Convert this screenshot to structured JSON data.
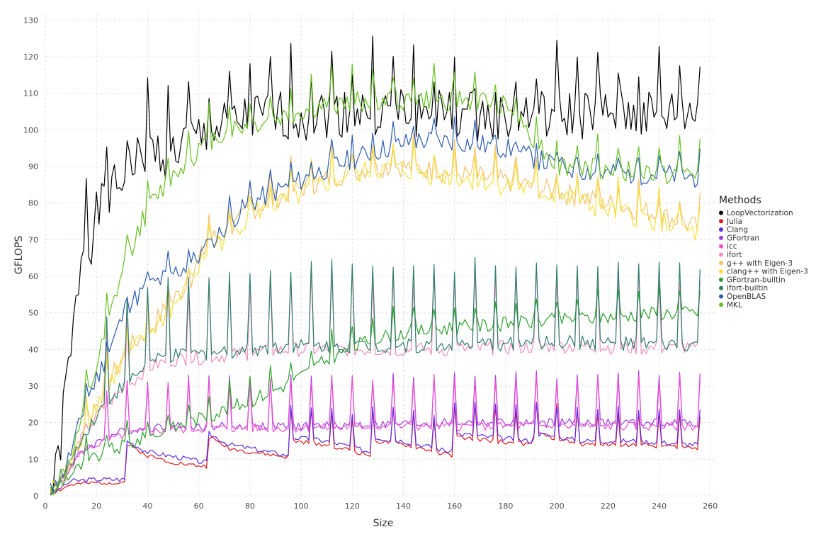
{
  "chart_data": {
    "type": "line",
    "title": "",
    "xlabel": "Size",
    "ylabel": "GFLOPS",
    "xlim": [
      0,
      262
    ],
    "ylim": [
      0,
      132
    ],
    "x_ticks": [
      0,
      20,
      40,
      60,
      80,
      100,
      120,
      140,
      160,
      180,
      200,
      220,
      240,
      260
    ],
    "y_ticks": [
      0,
      10,
      20,
      30,
      40,
      50,
      60,
      70,
      80,
      90,
      100,
      110,
      120,
      130
    ],
    "grid": true,
    "legend": {
      "title": "Methods",
      "placement": "right"
    },
    "x_domain": [
      2,
      256
    ],
    "series": [
      {
        "name": "LoopVectorization",
        "color": "#000000",
        "anchors": [
          [
            2,
            1
          ],
          [
            4,
            5
          ],
          [
            6,
            15
          ],
          [
            8,
            30
          ],
          [
            10,
            38
          ],
          [
            12,
            52
          ],
          [
            14,
            66
          ],
          [
            16,
            74
          ],
          [
            18,
            70
          ],
          [
            20,
            76
          ],
          [
            24,
            82
          ],
          [
            28,
            84
          ],
          [
            32,
            88
          ],
          [
            40,
            95
          ],
          [
            48,
            93
          ],
          [
            56,
            97
          ],
          [
            64,
            99
          ],
          [
            72,
            101
          ],
          [
            80,
            103
          ],
          [
            100,
            104
          ],
          [
            120,
            105
          ],
          [
            140,
            105
          ],
          [
            160,
            104
          ],
          [
            180,
            103
          ],
          [
            200,
            104
          ],
          [
            220,
            104
          ],
          [
            240,
            104
          ],
          [
            256,
            105
          ]
        ],
        "noise": 7,
        "spikes": {
          "period": 8,
          "amp": 14,
          "start": 16
        },
        "seed": 1
      },
      {
        "name": "Julia",
        "color": "#e41a1c",
        "anchors": [
          [
            2,
            0.5
          ],
          [
            10,
            3
          ],
          [
            20,
            3.5
          ],
          [
            31,
            3.8
          ],
          [
            32,
            14
          ],
          [
            40,
            11
          ],
          [
            48,
            9.5
          ],
          [
            56,
            8.5
          ],
          [
            63,
            8
          ],
          [
            64,
            16
          ],
          [
            72,
            13
          ],
          [
            80,
            12
          ],
          [
            95,
            10.5
          ],
          [
            96,
            15
          ],
          [
            110,
            14
          ],
          [
            127,
            11
          ],
          [
            128,
            15
          ],
          [
            140,
            14
          ],
          [
            159,
            11
          ],
          [
            160,
            16
          ],
          [
            190,
            14
          ],
          [
            192,
            17
          ],
          [
            210,
            14
          ],
          [
            230,
            14
          ],
          [
            256,
            13
          ]
        ],
        "noise": 0.6,
        "spikes": {
          "period": 8,
          "amp": 9,
          "start": 96
        },
        "seed": 2
      },
      {
        "name": "Clang",
        "color": "#5e2ce6",
        "anchors": [
          [
            2,
            0.5
          ],
          [
            10,
            4
          ],
          [
            20,
            4.5
          ],
          [
            31,
            4.5
          ],
          [
            32,
            15
          ],
          [
            40,
            12
          ],
          [
            48,
            11
          ],
          [
            56,
            10
          ],
          [
            63,
            9
          ],
          [
            64,
            17
          ],
          [
            72,
            14
          ],
          [
            80,
            13
          ],
          [
            95,
            11
          ],
          [
            96,
            16
          ],
          [
            110,
            15
          ],
          [
            127,
            12
          ],
          [
            128,
            16
          ],
          [
            140,
            15
          ],
          [
            159,
            12
          ],
          [
            160,
            17
          ],
          [
            190,
            15
          ],
          [
            192,
            17
          ],
          [
            210,
            15
          ],
          [
            230,
            15
          ],
          [
            256,
            14
          ]
        ],
        "noise": 0.7,
        "spikes": {
          "period": 8,
          "amp": 9,
          "start": 96
        },
        "seed": 3
      },
      {
        "name": "GFortran",
        "color": "#a23be0",
        "anchors": [
          [
            2,
            1
          ],
          [
            8,
            6
          ],
          [
            12,
            10
          ],
          [
            16,
            13
          ],
          [
            24,
            16
          ],
          [
            32,
            18
          ],
          [
            48,
            19
          ],
          [
            64,
            19
          ],
          [
            96,
            19
          ],
          [
            128,
            19.5
          ],
          [
            160,
            20
          ],
          [
            200,
            20
          ],
          [
            256,
            20
          ]
        ],
        "noise": 1.2,
        "spikes": {
          "period": 8,
          "amp": 13,
          "start": 24
        },
        "seed": 4
      },
      {
        "name": "icc",
        "color": "#ee4fd4",
        "anchors": [
          [
            2,
            1
          ],
          [
            8,
            6
          ],
          [
            12,
            10
          ],
          [
            16,
            13
          ],
          [
            24,
            15
          ],
          [
            32,
            17
          ],
          [
            48,
            18
          ],
          [
            64,
            18.5
          ],
          [
            96,
            18.5
          ],
          [
            128,
            19
          ],
          [
            160,
            19
          ],
          [
            200,
            19
          ],
          [
            256,
            19
          ]
        ],
        "noise": 1.2,
        "spikes": {
          "period": 8,
          "amp": 13,
          "start": 24
        },
        "seed": 5
      },
      {
        "name": "ifort",
        "color": "#f08fc0",
        "anchors": [
          [
            2,
            1
          ],
          [
            8,
            6
          ],
          [
            12,
            12
          ],
          [
            16,
            18
          ],
          [
            24,
            25
          ],
          [
            32,
            30
          ],
          [
            40,
            35
          ],
          [
            48,
            37
          ],
          [
            64,
            38
          ],
          [
            96,
            40
          ],
          [
            128,
            40
          ],
          [
            160,
            40
          ],
          [
            200,
            41
          ],
          [
            256,
            40
          ]
        ],
        "noise": 2,
        "spikes": {
          "period": 8,
          "amp": 20,
          "start": 24
        },
        "seed": 6
      },
      {
        "name": "g++ with Eigen-3",
        "color": "#f5c26b",
        "anchors": [
          [
            2,
            1
          ],
          [
            8,
            6
          ],
          [
            12,
            12
          ],
          [
            16,
            20
          ],
          [
            24,
            30
          ],
          [
            32,
            40
          ],
          [
            40,
            45
          ],
          [
            48,
            52
          ],
          [
            56,
            58
          ],
          [
            64,
            70
          ],
          [
            72,
            72
          ],
          [
            80,
            78
          ],
          [
            96,
            83
          ],
          [
            112,
            87
          ],
          [
            128,
            90
          ],
          [
            140,
            90
          ],
          [
            160,
            88
          ],
          [
            180,
            86
          ],
          [
            200,
            83
          ],
          [
            220,
            80
          ],
          [
            240,
            77
          ],
          [
            256,
            73
          ]
        ],
        "noise": 3,
        "spikes": {
          "period": 8,
          "amp": 7,
          "start": 16
        },
        "seed": 7
      },
      {
        "name": "clang++ with Eigen-3",
        "color": "#f7e03c",
        "anchors": [
          [
            2,
            1
          ],
          [
            8,
            6
          ],
          [
            12,
            12
          ],
          [
            16,
            20
          ],
          [
            24,
            30
          ],
          [
            32,
            38
          ],
          [
            40,
            44
          ],
          [
            48,
            50
          ],
          [
            56,
            57
          ],
          [
            64,
            68
          ],
          [
            72,
            71
          ],
          [
            80,
            77
          ],
          [
            96,
            81
          ],
          [
            112,
            86
          ],
          [
            128,
            89
          ],
          [
            140,
            89
          ],
          [
            160,
            87
          ],
          [
            180,
            85
          ],
          [
            200,
            82
          ],
          [
            220,
            78
          ],
          [
            240,
            75
          ],
          [
            256,
            71
          ]
        ],
        "noise": 3,
        "spikes": {
          "period": 8,
          "amp": 7,
          "start": 16
        },
        "seed": 8
      },
      {
        "name": "GFortran-builtin",
        "color": "#2ca02c",
        "anchors": [
          [
            2,
            1
          ],
          [
            8,
            5
          ],
          [
            16,
            9
          ],
          [
            24,
            12
          ],
          [
            32,
            14
          ],
          [
            40,
            16
          ],
          [
            48,
            18
          ],
          [
            64,
            22
          ],
          [
            80,
            26
          ],
          [
            96,
            31
          ],
          [
            112,
            38
          ],
          [
            128,
            43
          ],
          [
            144,
            45
          ],
          [
            160,
            46
          ],
          [
            180,
            47
          ],
          [
            200,
            48
          ],
          [
            220,
            49
          ],
          [
            240,
            50
          ],
          [
            256,
            50
          ]
        ],
        "noise": 2,
        "spikes": {
          "period": 8,
          "amp": 6,
          "start": 16
        },
        "seed": 9
      },
      {
        "name": "ifort-builtin",
        "color": "#2e7d6b",
        "anchors": [
          [
            2,
            1
          ],
          [
            8,
            6
          ],
          [
            12,
            12
          ],
          [
            16,
            18
          ],
          [
            24,
            26
          ],
          [
            32,
            31
          ],
          [
            40,
            36
          ],
          [
            48,
            38
          ],
          [
            64,
            39
          ],
          [
            96,
            41
          ],
          [
            128,
            41
          ],
          [
            160,
            41
          ],
          [
            200,
            42
          ],
          [
            256,
            41
          ]
        ],
        "noise": 2,
        "spikes": {
          "period": 8,
          "amp": 22,
          "start": 24
        },
        "seed": 10
      },
      {
        "name": "OpenBLAS",
        "color": "#2b5cb0",
        "anchors": [
          [
            2,
            1
          ],
          [
            8,
            8
          ],
          [
            12,
            16
          ],
          [
            16,
            26
          ],
          [
            24,
            38
          ],
          [
            32,
            52
          ],
          [
            40,
            57
          ],
          [
            48,
            60
          ],
          [
            56,
            63
          ],
          [
            64,
            68
          ],
          [
            72,
            75
          ],
          [
            80,
            80
          ],
          [
            96,
            85
          ],
          [
            112,
            90
          ],
          [
            128,
            94
          ],
          [
            144,
            97
          ],
          [
            160,
            97
          ],
          [
            180,
            95
          ],
          [
            200,
            90
          ],
          [
            220,
            88
          ],
          [
            240,
            88
          ],
          [
            256,
            87
          ]
        ],
        "noise": 3,
        "spikes": {
          "period": 8,
          "amp": 5,
          "start": 16
        },
        "seed": 11
      },
      {
        "name": "MKL",
        "color": "#66c01f",
        "anchors": [
          [
            2,
            1
          ],
          [
            8,
            7
          ],
          [
            12,
            15
          ],
          [
            16,
            25
          ],
          [
            20,
            35
          ],
          [
            24,
            45
          ],
          [
            28,
            56
          ],
          [
            32,
            65
          ],
          [
            36,
            72
          ],
          [
            40,
            78
          ],
          [
            48,
            86
          ],
          [
            56,
            92
          ],
          [
            64,
            97
          ],
          [
            72,
            100
          ],
          [
            80,
            101
          ],
          [
            96,
            104
          ],
          [
            112,
            107
          ],
          [
            128,
            108
          ],
          [
            144,
            108
          ],
          [
            160,
            108
          ],
          [
            180,
            107
          ],
          [
            200,
            90
          ],
          [
            220,
            89
          ],
          [
            240,
            88
          ],
          [
            256,
            88
          ]
        ],
        "noise": 3,
        "spikes": {
          "period": 8,
          "amp": 8,
          "start": 16
        },
        "seed": 12
      }
    ]
  }
}
